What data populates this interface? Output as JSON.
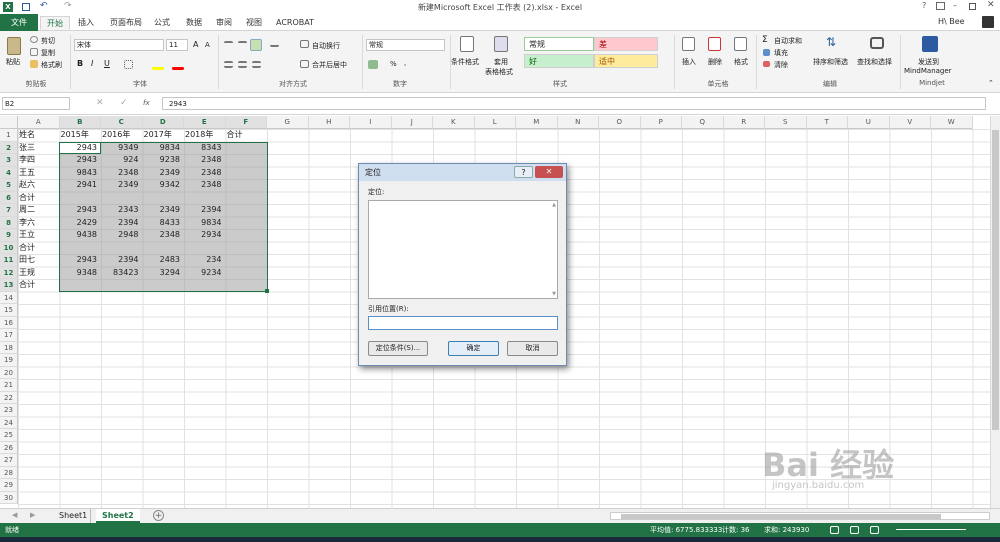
{
  "app": {
    "title": "新建Microsoft Excel 工作表 (2).xlsx - Excel",
    "user": "H\\ Bee"
  },
  "tabs": [
    "文件",
    "开始",
    "插入",
    "页面布局",
    "公式",
    "数据",
    "审阅",
    "视图",
    "ACROBAT"
  ],
  "ribbon": {
    "clipboard": {
      "paste": "粘贴",
      "cut": "剪切",
      "copy": "复制",
      "format_painter": "格式刷",
      "label": "剪贴板"
    },
    "font": {
      "name": "宋体",
      "size": "11",
      "label": "字体",
      "bold": "B",
      "italic": "I",
      "underline": "U",
      "grow": "A",
      "shrink": "A"
    },
    "alignment": {
      "wrap": "自动换行",
      "merge": "合并后居中",
      "label": "对齐方式"
    },
    "number": {
      "format": "常规",
      "label": "数字",
      "percent": "%",
      "comma": ","
    },
    "styles": {
      "conditional": "条件格式",
      "table": "套用",
      "table2": "表格格式",
      "normal": "常规",
      "bad": "差",
      "good": "好",
      "neutral": "适中",
      "label": "样式"
    },
    "cells": {
      "insert": "插入",
      "delete": "删除",
      "format": "格式",
      "label": "单元格"
    },
    "editing": {
      "autosum": "自动求和",
      "fill": "填充",
      "clear": "清除",
      "sort": "排序和筛选",
      "find": "查找和选择",
      "label": "编辑"
    },
    "mindjet": {
      "send": "发送到",
      "send2": "MindManager",
      "label": "Mindjet"
    }
  },
  "formula_bar": {
    "name_box": "B2",
    "fx": "fx",
    "value": "2943"
  },
  "columns": [
    "A",
    "B",
    "C",
    "D",
    "E",
    "F",
    "G",
    "H",
    "I",
    "J",
    "K",
    "L",
    "M",
    "N",
    "O",
    "P",
    "Q",
    "R",
    "S",
    "T",
    "U",
    "V",
    "W"
  ],
  "rows": [
    "1",
    "2",
    "3",
    "4",
    "5",
    "6",
    "7",
    "8",
    "9",
    "10",
    "11",
    "12",
    "13",
    "14",
    "15",
    "16",
    "17",
    "18",
    "19",
    "20",
    "21",
    "22",
    "23",
    "24",
    "25",
    "26",
    "27",
    "28",
    "29",
    "30"
  ],
  "table": {
    "header": [
      "姓名",
      "2015年",
      "2016年",
      "2017年",
      "2018年",
      "合计"
    ],
    "body": [
      [
        "张三",
        "2943",
        "9349",
        "9834",
        "8343",
        ""
      ],
      [
        "李四",
        "2943",
        "924",
        "9238",
        "2348",
        ""
      ],
      [
        "王五",
        "9843",
        "2348",
        "2349",
        "2348",
        ""
      ],
      [
        "赵六",
        "2941",
        "2349",
        "9342",
        "2348",
        ""
      ],
      [
        "合计",
        "",
        "",
        "",
        "",
        ""
      ],
      [
        "周二",
        "2943",
        "2343",
        "2349",
        "2394",
        ""
      ],
      [
        "李六",
        "2429",
        "2394",
        "8433",
        "9834",
        ""
      ],
      [
        "王立",
        "9438",
        "2948",
        "2348",
        "2934",
        ""
      ],
      [
        "合计",
        "",
        "",
        "",
        "",
        ""
      ],
      [
        "田七",
        "2943",
        "2394",
        "2483",
        "234",
        ""
      ],
      [
        "王规",
        "9348",
        "83423",
        "3294",
        "9234",
        ""
      ],
      [
        "合计",
        "",
        "",
        "",
        "",
        ""
      ]
    ]
  },
  "sheets": [
    "Sheet1",
    "Sheet2"
  ],
  "active_sheet": "Sheet2",
  "status": {
    "ready": "就绪",
    "average": "平均值: 6775.833333",
    "count": "计数: 36",
    "sum": "求和: 243930"
  },
  "dialog": {
    "title": "定位",
    "help": "?",
    "close": "✕",
    "list_label": "定位:",
    "ref_label": "引用位置(R):",
    "ref_value": "",
    "special_button": "定位条件(S)...",
    "ok_button": "确定",
    "cancel_button": "取消"
  },
  "watermark": {
    "text": "Bai 经验",
    "url": "jingyan.baidu.com"
  },
  "colors": {
    "excel_green": "#217346",
    "selection": "#c6c6c6",
    "bad_bg": "#ffc7ce",
    "good_bg": "#c6efce",
    "neutral_bg": "#ffeb9c"
  }
}
